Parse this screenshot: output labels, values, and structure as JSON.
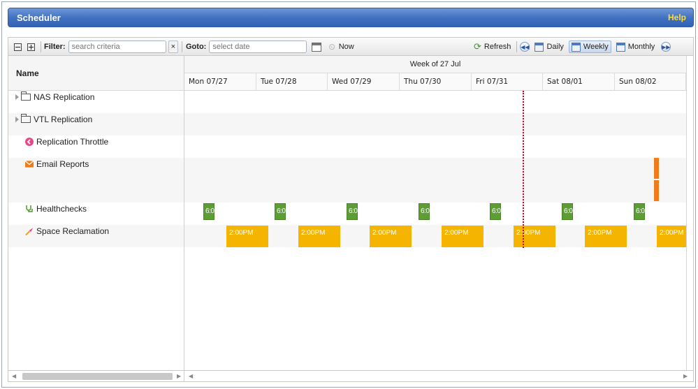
{
  "title": "Scheduler",
  "help_label": "Help",
  "toolbar": {
    "filter_label": "Filter:",
    "filter_placeholder": "search criteria",
    "clear_label": "×",
    "goto_label": "Goto:",
    "goto_placeholder": "select date",
    "now_label": "Now",
    "refresh_label": "Refresh",
    "daily_label": "Daily",
    "weekly_label": "Weekly",
    "monthly_label": "Monthly",
    "active_view": "Weekly"
  },
  "grid": {
    "name_header": "Name",
    "week_label": "Week of 27 Jul",
    "days": [
      "Mon 07/27",
      "Tue 07/28",
      "Wed 07/29",
      "Thu 07/30",
      "Fri 07/31",
      "Sat 08/01",
      "Sun 08/02"
    ]
  },
  "rows": [
    {
      "name": "NAS Replication",
      "icon": "folder-icon",
      "expandable": true
    },
    {
      "name": "VTL Replication",
      "icon": "folder-icon",
      "expandable": true
    },
    {
      "name": "Replication Throttle",
      "icon": "throttle-icon",
      "expandable": false
    },
    {
      "name": "Email Reports",
      "icon": "email-icon",
      "expandable": false
    },
    {
      "name": "Healthchecks",
      "icon": "stethoscope-icon",
      "expandable": false
    },
    {
      "name": "Space Reclamation",
      "icon": "reclaim-icon",
      "expandable": false
    }
  ],
  "healthcheck_label": "6:0",
  "reclaim_label": "2:00PM",
  "colors": {
    "titlebar": "#3f6fc0",
    "help": "#ffdd33",
    "healthcheck": "#5d9e34",
    "reclamation": "#f4b400",
    "email": "#ef7b19",
    "now_line": "#d9001b"
  }
}
